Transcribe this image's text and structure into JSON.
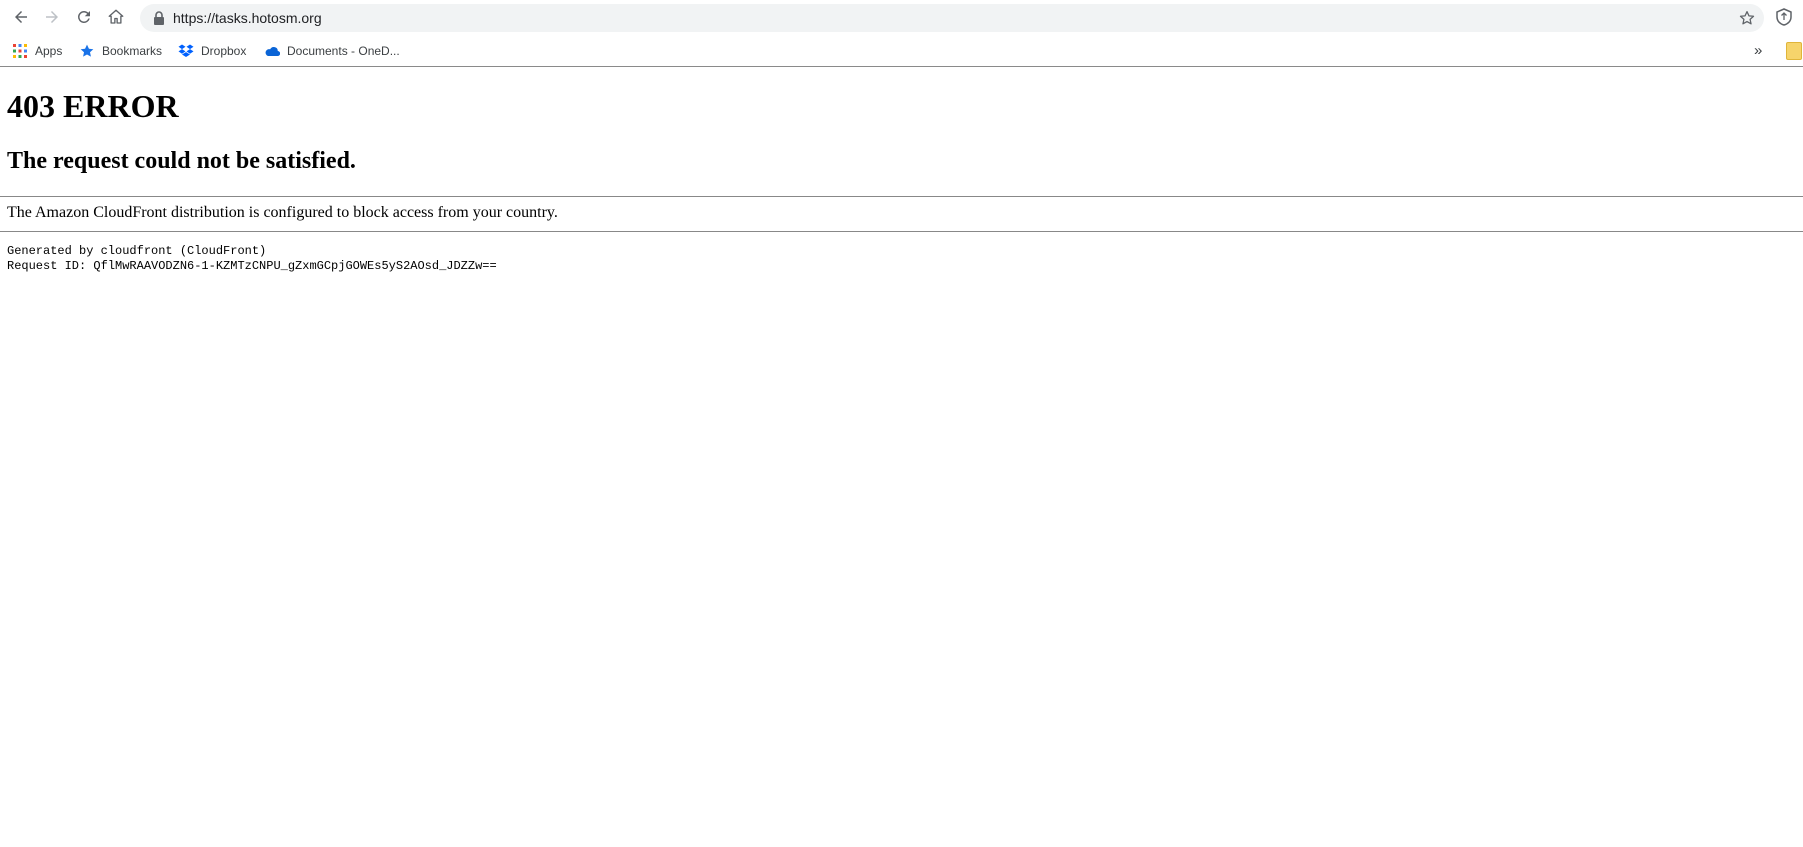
{
  "browser": {
    "url": "https://tasks.hotosm.org",
    "bookmarks": [
      {
        "label": "Apps",
        "icon": "apps-grid-icon"
      },
      {
        "label": "Bookmarks",
        "icon": "star-icon"
      },
      {
        "label": "Dropbox",
        "icon": "dropbox-icon"
      },
      {
        "label": "Documents - OneD...",
        "icon": "onedrive-cloud-icon"
      }
    ],
    "overflow_label": "»"
  },
  "page": {
    "title": "403 ERROR",
    "subtitle": "The request could not be satisfied.",
    "message": "The Amazon CloudFront distribution is configured to block access from your country.",
    "generated_by": "Generated by cloudfront (CloudFront)",
    "request_id": "Request ID: QflMwRAAVODZN6-1-KZMTzCNPU_gZxmGCpjGOWEs5yS2AOsd_JDZZw=="
  },
  "colors": {
    "omnibox_bg": "#f1f3f4",
    "text": "#000000",
    "rule": "#888888",
    "dropbox_blue": "#0061fe",
    "onedrive_blue": "#0a64d6"
  }
}
